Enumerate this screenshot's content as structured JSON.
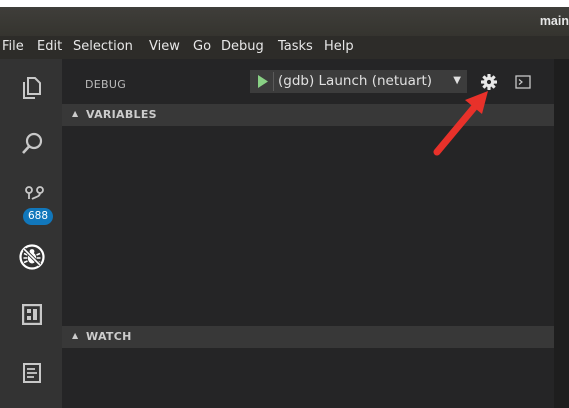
{
  "window": {
    "title": "main"
  },
  "menu": [
    "File",
    "Edit",
    "Selection",
    "View",
    "Go",
    "Debug",
    "Tasks",
    "Help"
  ],
  "activity_bar": {
    "items": [
      {
        "icon": "explorer-icon"
      },
      {
        "icon": "search-icon"
      },
      {
        "icon": "source-control-icon",
        "badge": "688"
      },
      {
        "icon": "debug-icon",
        "active": true
      },
      {
        "icon": "extensions-icon"
      },
      {
        "icon": "terminal-panel-icon"
      }
    ]
  },
  "debug": {
    "header_label": "DEBUG",
    "configuration": "(gdb) Launch (netuart)",
    "start_icon": "play-icon",
    "config_icon": "gear-icon",
    "console_icon": "debug-console-icon"
  },
  "sections": {
    "variables": "VARIABLES",
    "watch": "WATCH"
  },
  "annotation": {
    "type": "arrow",
    "color": "#e8312a",
    "points_to": "gear-icon"
  },
  "colors": {
    "sidebar_bg": "#252526",
    "activity_bar_bg": "#333333",
    "section_header_bg": "#383838",
    "badge_bg": "#1177bb",
    "play_green": "#89d185"
  }
}
